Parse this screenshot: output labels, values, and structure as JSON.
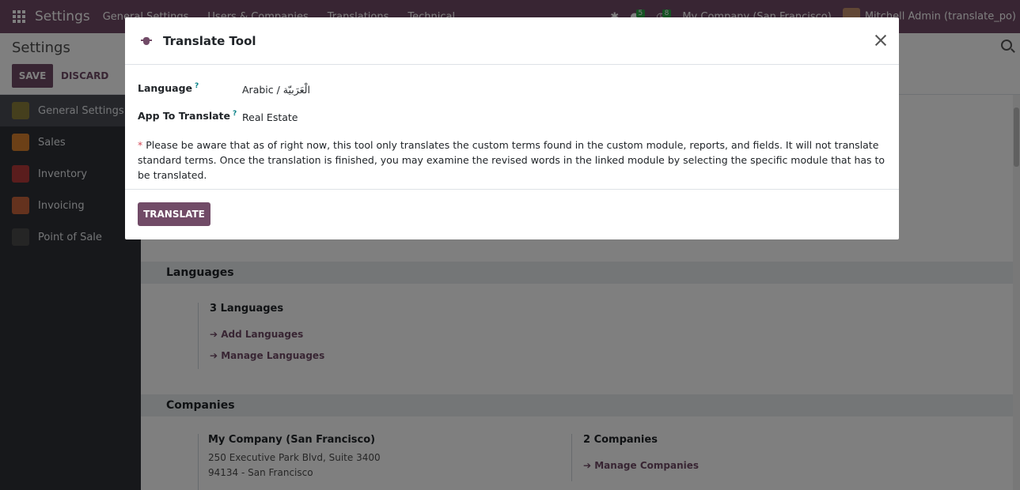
{
  "navbar": {
    "app_title": "Settings",
    "menu": [
      "General Settings",
      "Users & Companies",
      "Translations",
      "Technical"
    ],
    "messages_count": "5",
    "activities_count": "8",
    "company": "My Company (San Francisco)",
    "user": "Mitchell Admin (translate_po)"
  },
  "control_panel": {
    "title": "Settings",
    "save_label": "SAVE",
    "discard_label": "DISCARD"
  },
  "sidebar": {
    "items": [
      {
        "label": "General Settings",
        "color": "#8a7f3a"
      },
      {
        "label": "Sales",
        "color": "#d9812f"
      },
      {
        "label": "Inventory",
        "color": "#b43a3a"
      },
      {
        "label": "Invoicing",
        "color": "#c8643c"
      },
      {
        "label": "Point of Sale",
        "color": "#4a4a4a"
      }
    ]
  },
  "main": {
    "languages": {
      "heading": "Languages",
      "count": "3 Languages",
      "add": "Add Languages",
      "manage": "Manage Languages"
    },
    "companies": {
      "heading": "Companies",
      "company_name": "My Company (San Francisco)",
      "address_line1": "250 Executive Park Blvd, Suite 3400",
      "address_line2": "94134 - San Francisco",
      "count": "2 Companies",
      "manage": "Manage Companies"
    }
  },
  "modal": {
    "title": "Translate Tool",
    "language_label": "Language",
    "language_value": "Arabic / الْعَرَبيّة",
    "app_label": "App To Translate",
    "app_value": "Real Estate",
    "help_mark": "?",
    "required_mark": "*",
    "note": "Please be aware that as of right now, this tool only translates the custom terms found in the custom module, reports, and fields. It will not translate standard terms. Once the translation is finished, you may examine the revised words in the linked module by selecting the specific module that has to be translated.",
    "translate_label": "TRANSLATE"
  },
  "colors": {
    "brand": "#714B67",
    "sidebar_bg": "#2f3136"
  }
}
